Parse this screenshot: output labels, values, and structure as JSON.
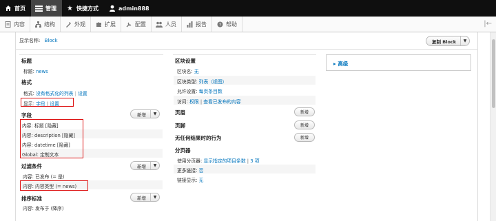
{
  "toolbar": {
    "home": "首页",
    "manage": "管理",
    "shortcuts": "快捷方式",
    "user": "admin888"
  },
  "tray": {
    "items": [
      {
        "label": "内容",
        "icon": "content-icon"
      },
      {
        "label": "结构",
        "icon": "structure-icon"
      },
      {
        "label": "外观",
        "icon": "appearance-icon"
      },
      {
        "label": "扩展",
        "icon": "extend-icon"
      },
      {
        "label": "配置",
        "icon": "config-icon"
      },
      {
        "label": "人员",
        "icon": "people-icon"
      },
      {
        "label": "报告",
        "icon": "reports-icon"
      },
      {
        "label": "帮助",
        "icon": "help-icon"
      }
    ]
  },
  "display": {
    "name_label": "显示名称:",
    "name_value": "Block",
    "duplicate_label": "复制 Block"
  },
  "left": {
    "title_heading": "标题",
    "title_label": "标题:",
    "title_value": "news",
    "format_heading": "格式",
    "format_label": "格式:",
    "format_value": "没有格式化的列表",
    "format_settings": "设置",
    "show_label": "显示:",
    "show_fields": "字段",
    "show_sep": "|",
    "show_settings": "设置",
    "fields_heading": "字段",
    "add_label": "新增",
    "fields": [
      "内容: 标题 [隐藏]",
      "内容: description [隐藏]",
      "内容: datetime [隐藏]",
      "Global: 定制文本"
    ],
    "filter_heading": "过滤条件",
    "filters": [
      "内容: 已发布 (= 是)",
      "内容: 内容类型 (= news)"
    ],
    "sort_heading": "排序标准",
    "sorts": [
      "内容: 发布于 (降序)"
    ]
  },
  "middle": {
    "block_heading": "区块设置",
    "block_name_label": "区块名:",
    "block_name_value": "无",
    "block_type_label": "区块类型:",
    "block_type_value": "列表（视图）",
    "allow_label": "允许设置:",
    "allow_value": "每页条目数",
    "access_label": "访问:",
    "access_value": "权限",
    "access_sep": "|",
    "access_extra": "查看已发布的内容",
    "header_heading": "页眉",
    "footer_heading": "页脚",
    "noresult_heading": "无任何结果时的行为",
    "add_label": "新增",
    "pager_heading": "分页器",
    "pager_label": "使用分页器:",
    "pager_value": "显示指定的项目条数",
    "pager_sep": "|",
    "pager_count": "3 项",
    "more_label": "更多链接:",
    "more_value": "否",
    "link_label": "链接显示:",
    "link_value": "无"
  },
  "advanced": {
    "label": "高级"
  },
  "colors": {
    "toolbar_bg": "#0f0f0f",
    "link": "#0074bd",
    "highlight": "#dd1111"
  }
}
